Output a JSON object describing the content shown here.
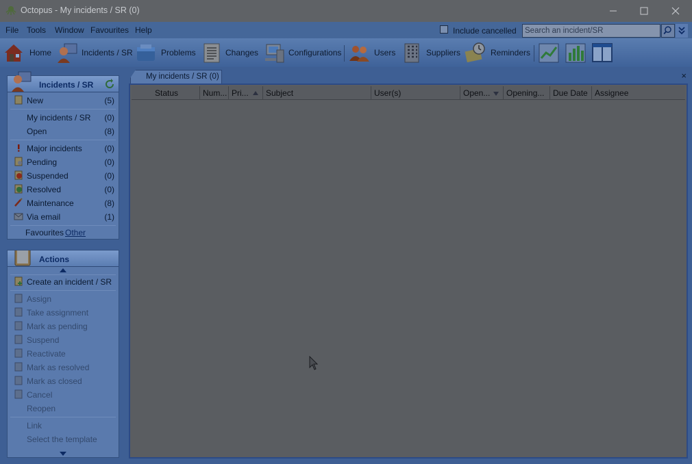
{
  "window": {
    "title": "Octopus - My incidents / SR (0)"
  },
  "menu": [
    "File",
    "Tools",
    "Window",
    "Favourites",
    "Help"
  ],
  "top_controls": {
    "include_cancelled_label": "Include cancelled",
    "include_cancelled_checked": false,
    "search_placeholder": "Search an incident/SR"
  },
  "toolbar": {
    "items": [
      {
        "label": "Home",
        "icon": "home-icon"
      },
      {
        "label": "Incidents / SR",
        "icon": "incidents-icon"
      },
      {
        "label": "Problems",
        "icon": "problems-icon"
      },
      {
        "label": "Changes",
        "icon": "changes-icon"
      },
      {
        "label": "Configurations",
        "icon": "configurations-icon"
      },
      {
        "label": "Users",
        "icon": "users-icon"
      },
      {
        "label": "Suppliers",
        "icon": "suppliers-icon"
      },
      {
        "label": "Reminders",
        "icon": "reminders-icon"
      }
    ],
    "extra_icons": [
      "chart-icon",
      "bar-chart-icon",
      "layout-icon"
    ]
  },
  "incidents_panel": {
    "title": "Incidents / SR",
    "items": [
      {
        "label": "New",
        "count": "(5)"
      },
      {
        "label": "My incidents / SR",
        "count": "(0)"
      },
      {
        "label": "Open",
        "count": "(8)"
      },
      {
        "label": "Major incidents",
        "count": "(0)"
      },
      {
        "label": "Pending",
        "count": "(0)"
      },
      {
        "label": "Suspended",
        "count": "(0)"
      },
      {
        "label": "Resolved",
        "count": "(0)"
      },
      {
        "label": "Maintenance",
        "count": "(8)"
      },
      {
        "label": "Via email",
        "count": "(1)"
      }
    ],
    "favourites_label": "Favourites",
    "other_link": "Other"
  },
  "actions_panel": {
    "title": "Actions",
    "items": [
      {
        "label": "Create an incident / SR",
        "enabled": true
      },
      {
        "label": "Assign",
        "enabled": false
      },
      {
        "label": "Take assignment",
        "enabled": false
      },
      {
        "label": "Mark as pending",
        "enabled": false
      },
      {
        "label": "Suspend",
        "enabled": false
      },
      {
        "label": "Reactivate",
        "enabled": false
      },
      {
        "label": "Mark as resolved",
        "enabled": false
      },
      {
        "label": "Mark as closed",
        "enabled": false
      },
      {
        "label": "Cancel",
        "enabled": false
      },
      {
        "label": "Reopen",
        "enabled": false
      },
      {
        "label": "Link",
        "enabled": false
      },
      {
        "label": "Select the template",
        "enabled": false
      }
    ]
  },
  "tab": {
    "label": "My incidents / SR (0)",
    "close": "×"
  },
  "grid": {
    "columns": [
      "Status",
      "Num...",
      "Pri...",
      "Subject",
      "User(s)",
      "Open...",
      "Opening...",
      "Due Date",
      "Assignee"
    ],
    "rows": []
  },
  "colors": {
    "overlay_blue": "#3e5f94",
    "header_blue": "#0c2a63"
  }
}
